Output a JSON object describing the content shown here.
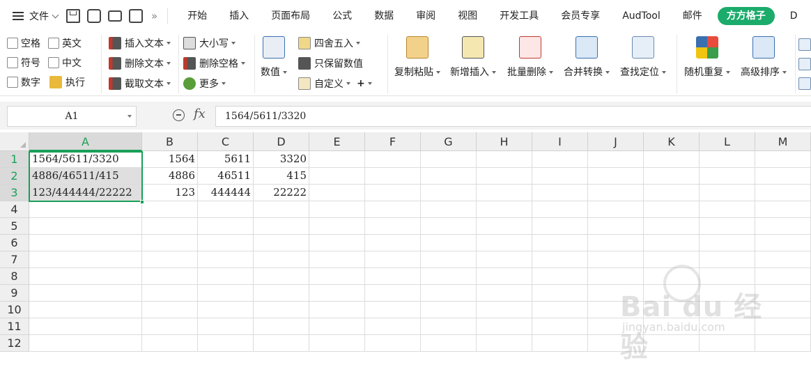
{
  "menubar": {
    "file_label": "文件",
    "tabs": [
      "开始",
      "插入",
      "页面布局",
      "公式",
      "数据",
      "审阅",
      "视图",
      "开发工具",
      "会员专享",
      "AudTool",
      "邮件",
      "方方格子",
      "D"
    ],
    "active_tab": "方方格子"
  },
  "ribbon": {
    "checkboxes": [
      "空格",
      "英文",
      "符号",
      "中文",
      "数字"
    ],
    "execute_label": "执行",
    "insert_text": "插入文本",
    "delete_text": "删除文本",
    "cut_text": "截取文本",
    "case_label": "大小写",
    "delete_space": "删除空格",
    "more_label": "更多",
    "value_label": "数值",
    "round_label": "四舍五入",
    "keep_value": "只保留数值",
    "custom_label": "自定义",
    "copy_paste": "复制粘贴",
    "add_insert": "新增插入",
    "batch_delete": "批量删除",
    "merge_convert": "合并转换",
    "find_locate": "查找定位",
    "random_repeat": "随机重复",
    "adv_sort": "高级排序"
  },
  "formula_bar": {
    "name_box": "A1",
    "fx": "fx",
    "content": "1564/5611/3320"
  },
  "grid": {
    "columns": [
      "A",
      "B",
      "C",
      "D",
      "E",
      "F",
      "G",
      "H",
      "I",
      "J",
      "K",
      "L",
      "M"
    ],
    "rows": [
      "1",
      "2",
      "3",
      "4",
      "5",
      "6",
      "7",
      "8",
      "9",
      "10",
      "11",
      "12"
    ],
    "cells": {
      "A1": "1564/5611/3320",
      "B1": "1564",
      "C1": "5611",
      "D1": "3320",
      "A2": "4886/46511/415",
      "B2": "4886",
      "C2": "46511",
      "D2": "415",
      "A3": "123/444444/22222",
      "B3": "123",
      "C3": "444444",
      "D3": "22222"
    },
    "selected_range": "A1:A3"
  },
  "watermark": {
    "brand": "Bai du 经验",
    "url": "jingyan.baidu.com"
  },
  "colors": {
    "accent": "#18a058",
    "vip_tab": "#1bab6b",
    "header_bg": "#efefef",
    "selected_header_bg": "#dadada"
  }
}
